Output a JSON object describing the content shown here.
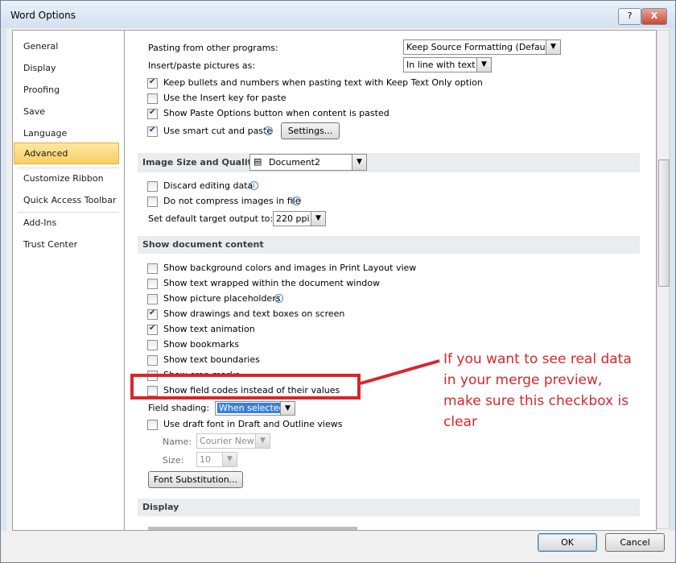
{
  "window": {
    "title": "Word Options",
    "help_label": "?",
    "close_label": "X"
  },
  "sidebar": {
    "items": [
      {
        "label": "General"
      },
      {
        "label": "Display"
      },
      {
        "label": "Proofing"
      },
      {
        "label": "Save"
      },
      {
        "label": "Language"
      },
      {
        "label": "Advanced",
        "selected": true
      },
      {
        "label": "Customize Ribbon"
      },
      {
        "label": "Quick Access Toolbar"
      },
      {
        "label": "Add-Ins"
      },
      {
        "label": "Trust Center"
      }
    ]
  },
  "cut_copy_paste": {
    "pasting_other_label": "Pasting from other programs:",
    "pasting_other_value": "Keep Source Formatting (Default)",
    "insert_pictures_label": "Insert/paste pictures as:",
    "insert_pictures_value": "In line with text",
    "keep_bullets": {
      "label": "Keep bullets and numbers when pasting text with Keep Text Only option",
      "checked": true
    },
    "insert_key": {
      "label": "Use the Insert key for paste",
      "checked": false
    },
    "paste_options": {
      "label": "Show Paste Options button when content is pasted",
      "checked": true
    },
    "smart_cut": {
      "label": "Use smart cut and paste",
      "checked": true
    },
    "settings_button": "Settings..."
  },
  "image_size": {
    "section_title": "Image Size and Quality",
    "document_value": "Document2",
    "discard": {
      "label": "Discard editing data",
      "checked": false
    },
    "no_compress": {
      "label": "Do not compress images in file",
      "checked": false
    },
    "target_output_label": "Set default target output to:",
    "target_output_value": "220 ppi"
  },
  "show_document": {
    "section_title": "Show document content",
    "items": [
      {
        "label": "Show background colors and images in Print Layout view",
        "checked": false
      },
      {
        "label": "Show text wrapped within the document window",
        "checked": false
      },
      {
        "label": "Show picture placeholders",
        "checked": false
      },
      {
        "label": "Show drawings and text boxes on screen",
        "checked": true
      },
      {
        "label": "Show text animation",
        "checked": true
      },
      {
        "label": "Show bookmarks",
        "checked": false
      },
      {
        "label": "Show text boundaries",
        "checked": false
      },
      {
        "label": "Show crop marks",
        "checked": false
      },
      {
        "label": "Show field codes instead of their values",
        "checked": false
      }
    ],
    "field_shading_label": "Field shading:",
    "field_shading_value": "When selected",
    "draft_font": {
      "label": "Use draft font in Draft and Outline views",
      "checked": false
    },
    "name_label": "Name:",
    "name_value": "Courier New",
    "size_label": "Size:",
    "size_value": "10",
    "font_substitution_button": "Font Substitution..."
  },
  "display_section": {
    "section_title": "Display"
  },
  "footer": {
    "ok_label": "OK",
    "cancel_label": "Cancel"
  },
  "annotation": {
    "text": "If you want to see real data in your merge preview, make sure this checkbox is clear",
    "color": "#d8262b"
  }
}
